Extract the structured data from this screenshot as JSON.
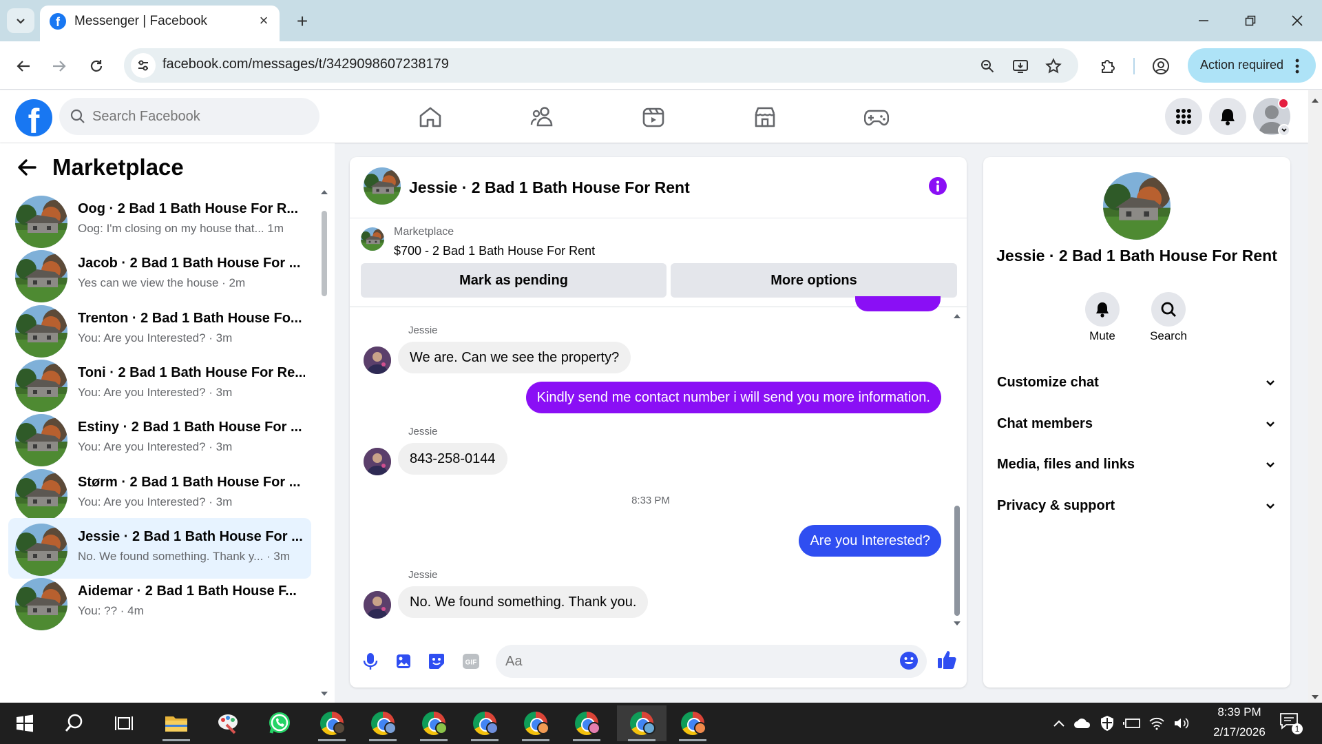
{
  "browser": {
    "tab_title": "Messenger | Facebook",
    "url": "facebook.com/messages/t/3429098607238179",
    "action_required": "Action required"
  },
  "fb": {
    "search_placeholder": "Search Facebook",
    "nav_icons": [
      "home-icon",
      "friends-icon",
      "watch-icon",
      "marketplace-icon",
      "gaming-icon"
    ],
    "brand_color": "#1877f2"
  },
  "left": {
    "title": "Marketplace",
    "conversations": [
      {
        "name": "Oog · 2 Bad 1 Bath House For R...",
        "preview": "Oog: I'm closing on my house that...  1m"
      },
      {
        "name": "Jacob · 2 Bad 1 Bath House For ...",
        "preview": "Yes can we view the house · 2m"
      },
      {
        "name": "Trenton · 2 Bad 1 Bath House Fo...",
        "preview": "You: Are you Interested? · 3m"
      },
      {
        "name": "Toni · 2 Bad 1 Bath House For Re...",
        "preview": "You: Are you Interested? · 3m"
      },
      {
        "name": "Estiny · 2 Bad 1 Bath House For ...",
        "preview": "You: Are you Interested? · 3m"
      },
      {
        "name": "Størm · 2 Bad 1 Bath House For ...",
        "preview": "You: Are you Interested? · 3m"
      },
      {
        "name": "Jessie · 2 Bad 1 Bath House For ...",
        "preview": "No. We found something. Thank y... · 3m"
      },
      {
        "name": "Aidemar · 2 Bad 1 Bath House F...",
        "preview": "You: ?? · 4m"
      }
    ]
  },
  "chat": {
    "title": "Jessie · 2 Bad 1 Bath House For Rent",
    "listing_category": "Marketplace",
    "listing_title": "$700 - 2 Bad 1 Bath House For Rent",
    "mark_pending": "Mark as pending",
    "more_options": "More options",
    "messages": [
      {
        "sender": "Jessie",
        "text": "We are. Can we see the property?"
      },
      {
        "text": "Kindly send me contact number i will send you more information."
      },
      {
        "sender": "Jessie",
        "text": "843-258-0144"
      },
      {
        "text": "Are you Interested?"
      },
      {
        "sender": "Jessie",
        "text": "No. We found something. Thank you."
      }
    ],
    "timestamp": "8:33 PM",
    "input_placeholder": "Aa",
    "out_color_1": "#8a0ff5",
    "out_color_2": "#2f4ef1"
  },
  "right": {
    "name": "Jessie · 2 Bad 1 Bath House For Rent",
    "mute": "Mute",
    "search": "Search",
    "sections": [
      "Customize chat",
      "Chat members",
      "Media, files and links",
      "Privacy & support"
    ]
  },
  "taskbar": {
    "time": "8:39 PM",
    "date": "2/17/2026",
    "notification_count": "1"
  }
}
